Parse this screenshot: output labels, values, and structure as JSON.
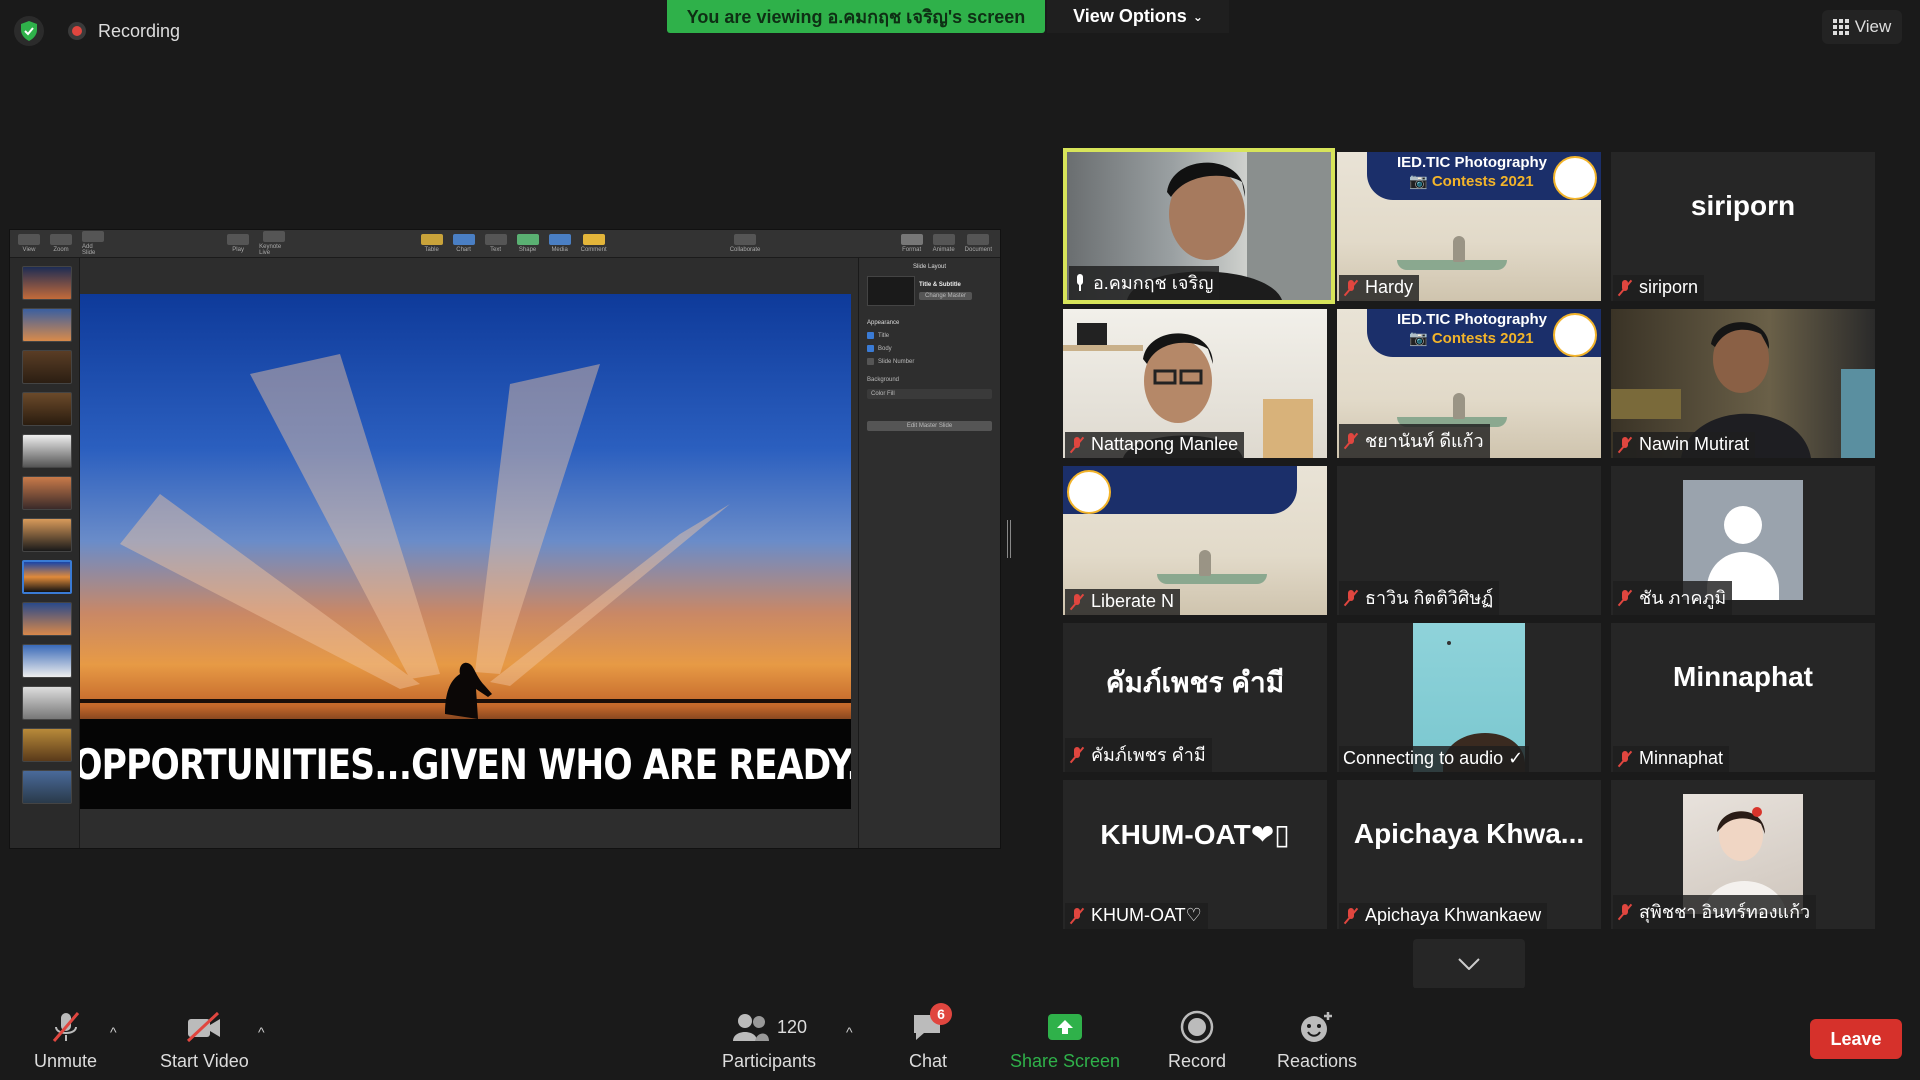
{
  "top": {
    "recording_label": "Recording",
    "viewing_banner": "You are viewing อ.คมกฤช เจริญ's screen",
    "view_options_label": "View Options",
    "view_label": "View"
  },
  "shared_slide": {
    "caption": "OPPORTUNITIES...GIVEN WHO ARE READY.",
    "inspector_heading": "Slide Layout",
    "inspector_layout": "Title & Subtitle",
    "inspector_change_master": "Change Master",
    "inspector_appearance": "Appearance",
    "inspector_title": "Title",
    "inspector_body": "Body",
    "inspector_slide_number": "Slide Number",
    "inspector_background": "Background",
    "inspector_color_fill": "Color Fill",
    "inspector_edit_master": "Edit Master Slide",
    "toolbar_items": [
      "View",
      "Zoom",
      "Add Slide",
      "Play",
      "Keynote Live",
      "Table",
      "Chart",
      "Text",
      "Shape",
      "Media",
      "Comment",
      "Collaborate",
      "Format",
      "Animate",
      "Document"
    ]
  },
  "participants_tiles": [
    {
      "name": "อ.คมกฤช เจริญ",
      "type": "video-person",
      "active": true,
      "muted": false
    },
    {
      "name": "Hardy",
      "type": "poster",
      "muted": true
    },
    {
      "name": "siriporn",
      "big": "siriporn",
      "type": "name",
      "muted": true
    },
    {
      "name": "Nattapong Manlee",
      "type": "video-person2",
      "muted": true
    },
    {
      "name": "ชยานันท์ ดีแก้ว",
      "type": "poster",
      "muted": true
    },
    {
      "name": "Nawin Mutirat",
      "type": "video-person3",
      "muted": true
    },
    {
      "name": "Liberate N",
      "type": "poster-flip",
      "muted": true
    },
    {
      "name": "ธาวิน กิตติวิศิษฏ์",
      "type": "blank",
      "muted": true
    },
    {
      "name": "ชัน ภาคภูมิ",
      "type": "avatar",
      "muted": true
    },
    {
      "name": "คัมภ์เพชร คำมี",
      "big": "คัมภ์เพชร คำมี",
      "type": "name",
      "muted": true
    },
    {
      "name": "Connecting to audio ✓",
      "type": "video-face",
      "muted": false
    },
    {
      "name": "Minnaphat",
      "big": "Minnaphat",
      "type": "name",
      "muted": true
    },
    {
      "name": "KHUM-OAT♡",
      "big": "KHUM-OAT❤▯",
      "type": "name",
      "muted": true
    },
    {
      "name": "Apichaya Khwankaew",
      "big": "Apichaya Khwa...",
      "type": "name",
      "muted": true
    },
    {
      "name": "สุพิชชา อินทร์ทองแก้ว",
      "type": "photo",
      "muted": true
    }
  ],
  "toolbar": {
    "unmute": "Unmute",
    "start_video": "Start Video",
    "participants": "Participants",
    "participants_count": "120",
    "chat": "Chat",
    "chat_badge": "6",
    "share_screen": "Share Screen",
    "record": "Record",
    "reactions": "Reactions",
    "leave": "Leave"
  },
  "colors": {
    "accent_green": "#2fb14a",
    "active_speaker": "#d7e45a",
    "leave_red": "#d6312b",
    "muted_red": "#e0463f"
  }
}
